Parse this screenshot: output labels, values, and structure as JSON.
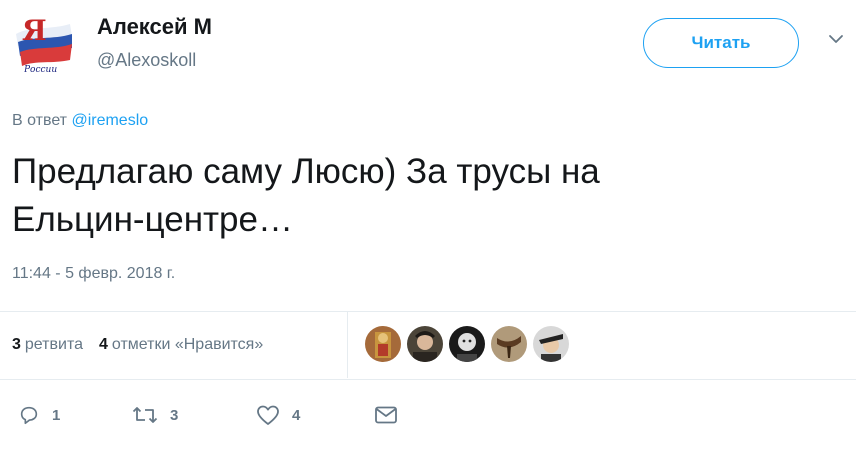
{
  "user": {
    "name": "Алексей М",
    "handle": "@Alexoskoll",
    "avatar_icon": "russia-flag-logo-icon",
    "avatar_text": "Я России"
  },
  "follow_button": {
    "label": "Читать"
  },
  "menu_icon": "chevron-down-icon",
  "reply_to": {
    "prefix": "В ответ ",
    "mention": "@iremeslo"
  },
  "tweet": {
    "text": "Предлагаю саму Люсю) За трусы на\nЕльцин-центре…",
    "timestamp": "11:44 - 5 февр. 2018 г."
  },
  "stats": {
    "retweets_count": "3",
    "retweets_label": "ретвита",
    "likes_count": "4",
    "likes_label": "отметки «Нравится»"
  },
  "likers": [
    {
      "icon": "liker-avatar-icon"
    },
    {
      "icon": "liker-avatar-icon"
    },
    {
      "icon": "liker-avatar-icon"
    },
    {
      "icon": "liker-avatar-icon"
    },
    {
      "icon": "liker-avatar-icon"
    }
  ],
  "actions": {
    "reply_count": "1",
    "retweet_count": "3",
    "like_count": "4",
    "reply_icon": "reply-icon",
    "retweet_icon": "retweet-icon",
    "like_icon": "heart-icon",
    "dm_icon": "envelope-icon"
  },
  "colors": {
    "accent": "#1da1f2",
    "secondary_text": "#657786",
    "primary_text": "#14171a",
    "divider": "#e6ecf0"
  }
}
